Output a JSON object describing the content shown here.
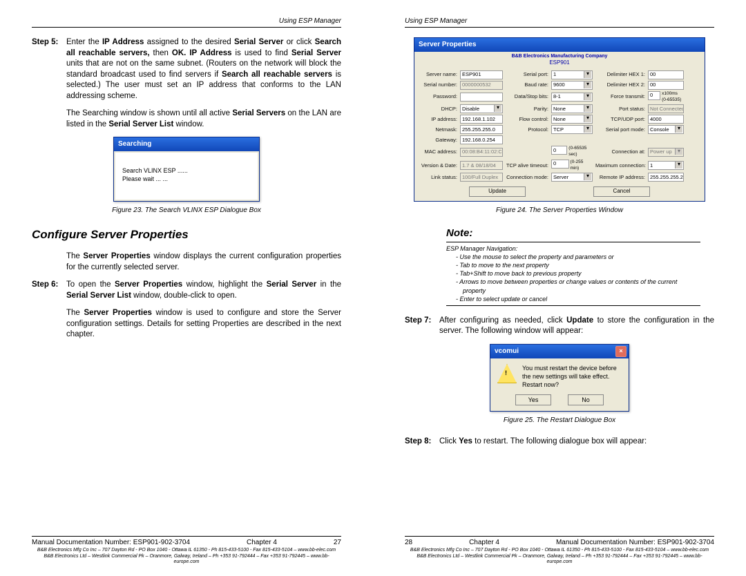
{
  "left": {
    "header": "Using ESP Manager",
    "step5_label": "Step 5:",
    "step5_text_1": "Enter the ",
    "step5_ip": "IP Address",
    "step5_text_2": " assigned to the desired ",
    "step5_ss": "Serial Server",
    "step5_text_3": " or click ",
    "step5_sar": "Search all reachable servers,",
    "step5_text_4": " then ",
    "step5_ok": "OK. IP Address",
    "step5_text_5": " is used to find ",
    "step5_ss2": "Serial Server",
    "step5_text_6": " units that are not on the same subnet. (Routers on the network will block the standard broadcast used to find servers if ",
    "step5_sar2": "Search all reachable servers",
    "step5_text_7": " is selected.) The user must set an IP address that conforms to the LAN addressing scheme.",
    "para1_a": "The Searching window is shown until all active ",
    "para1_b": "Serial Servers",
    "para1_c": " on the LAN are listed in the ",
    "para1_d": "Serial Server List",
    "para1_e": " window.",
    "search_title": "Searching",
    "search_line1": "Search VLINX ESP ......",
    "search_line2": "Please wait ... ...",
    "fig23": "Figure 23.    The Search VLINX ESP Dialogue Box",
    "h2": "Configure Server Properties",
    "para2_a": "The ",
    "para2_b": "Server Properties",
    "para2_c": " window displays the current configuration properties for the currently selected server.",
    "step6_label": "Step 6:",
    "step6_a": "To open the ",
    "step6_b": "Server Properties",
    "step6_c": " window, highlight the ",
    "step6_d": "Serial Server",
    "step6_e": " in the ",
    "step6_f": "Serial Server List",
    "step6_g": " window, double-click to open.",
    "para3_a": "The ",
    "para3_b": "Server Properties",
    "para3_c": " window is used to configure and store the Server configuration settings. Details for setting Properties are described in the next chapter.",
    "footer_doc": "Manual Documentation Number: ESP901-902-3704",
    "footer_ch": "Chapter 4",
    "footer_pg": "27",
    "footer_t1": "B&B Electronics Mfg Co Inc – 707 Dayton Rd - PO Box 1040 - Ottawa IL 61350 - Ph 815-433-5100 - Fax 815-433-5104 – www.bb-elec.com",
    "footer_t2": "B&B Electronics Ltd – Westlink Commercial Pk – Oranmore, Galway, Ireland – Ph +353 91-792444 – Fax +353 91-792445 – www.bb-europe.com"
  },
  "right": {
    "header": "Using ESP Manager",
    "sp_title": "Server Properties",
    "sp_company": "B&B Electronics Manufacturing Company",
    "sp_model": "ESP901",
    "labels": {
      "server_name": "Server name:",
      "serial_number": "Serial number:",
      "password": "Password:",
      "dhcp": "DHCP:",
      "ip": "IP address:",
      "netmask": "Netmask:",
      "gateway": "Gateway:",
      "mac": "MAC address:",
      "version": "Version & Date:",
      "link": "Link status:",
      "serial_port": "Serial port:",
      "baud": "Baud rate:",
      "dsb": "Data/Stop bits:",
      "parity": "Parity:",
      "flow": "Flow control:",
      "protocol": "Protocol:",
      "tcp_timeout": "TCP alive timeout:",
      "conn_mode": "Connection mode:",
      "dhex1": "Delimiter HEX 1:",
      "dhex2": "Delimiter HEX 2:",
      "force": "Force transmit:",
      "port_status": "Port status:",
      "tcpudp": "TCP/UDP port:",
      "spm": "Serial port mode:",
      "conn_at": "Connection at:",
      "maxconn": "Maximum connection:",
      "remote": "Remote IP address:",
      "range1": "(0-65535 sec)",
      "range2": "(0-255 min)",
      "force_unit": "x100ms (0-65535)"
    },
    "vals": {
      "server_name": "ESP901",
      "serial_number": "0000000532",
      "password": "",
      "dhcp": "Disable",
      "ip": "192.168.1.102",
      "netmask": "255.255.255.0",
      "gateway": "192.168.0.254",
      "mac": "00:08:B4:11:02:CA",
      "version": "1.7 & 08/18/04",
      "link": "100/Full Duplex",
      "serial_port": "1",
      "baud": "9600",
      "dsb": "8-1",
      "parity": "None",
      "flow": "None",
      "protocol": "TCP",
      "tcp_timeout_a": "0",
      "tcp_timeout_b": "0",
      "conn_mode": "Server",
      "dhex1": "00",
      "dhex2": "00",
      "force": "0",
      "port_status": "Not Connected",
      "tcpudp": "4000",
      "spm": "Console",
      "conn_at": "Power up",
      "maxconn": "1",
      "remote": "255.255.255.255"
    },
    "btn_update": "Update",
    "btn_cancel": "Cancel",
    "fig24": "Figure 24.  The Server Properties Window",
    "note_title": "Note:",
    "note_head": "ESP Manager Navigation:",
    "note1": "Use the mouse to select the property and parameters or",
    "note2": "Tab to move to the next property",
    "note3": "Tab+Shift to move back to previous property",
    "note4": "Arrows to move between properties or change values or contents of the current property",
    "note5": "Enter to select update or cancel",
    "step7_label": "Step 7:",
    "step7_a": "After configuring as needed, click ",
    "step7_b": "Update",
    "step7_c": " to store the configuration in the server. The following window will appear:",
    "vc_title": "vcomui",
    "vc_msg": "You must restart the device before the new settings will take effect. Restart now?",
    "vc_yes": "Yes",
    "vc_no": "No",
    "fig25": "Figure 25. The Restart Dialogue Box",
    "step8_label": "Step 8:",
    "step8_a": "Click ",
    "step8_b": "Yes",
    "step8_c": " to restart. The following dialogue box will appear:",
    "footer_pg": "28",
    "footer_ch": "Chapter 4",
    "footer_doc": "Manual Documentation Number: ESP901-902-3704"
  }
}
